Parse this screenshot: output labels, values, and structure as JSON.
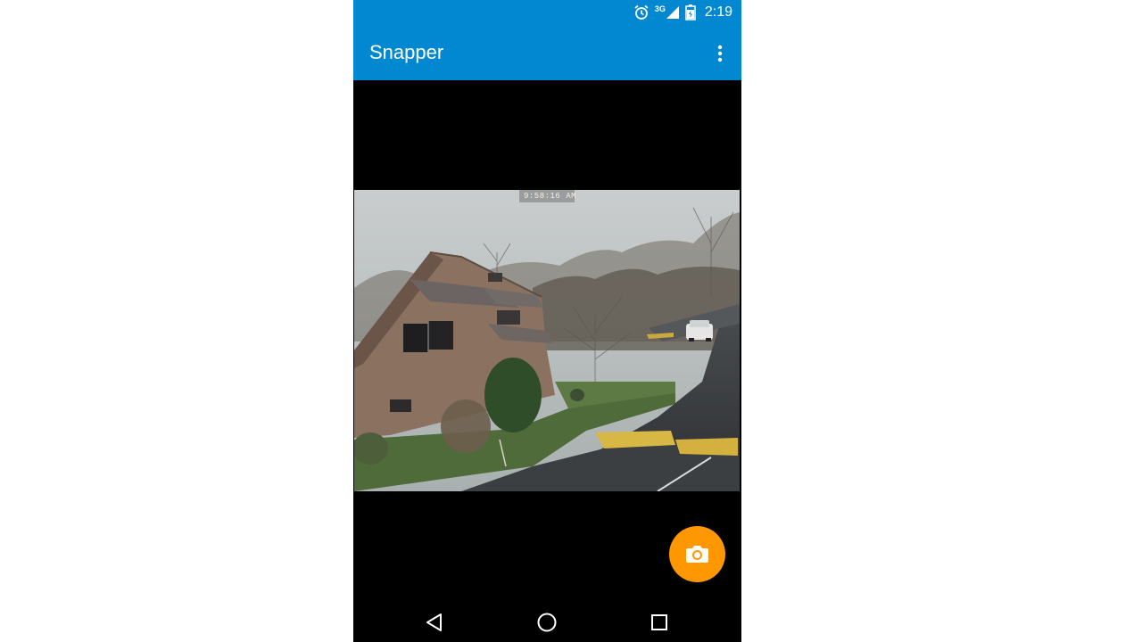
{
  "status_bar": {
    "time": "2:19",
    "network": "3G",
    "icons": [
      "alarm-icon",
      "signal-icon",
      "battery-icon"
    ]
  },
  "app_bar": {
    "title": "Snapper",
    "menu_icon": "more-vert-icon"
  },
  "camera_view": {
    "timestamp": "9:58:16 AM"
  },
  "fab": {
    "icon": "camera-icon",
    "color": "#ff9800"
  },
  "nav_bar": {
    "buttons": [
      "back-icon",
      "home-icon",
      "recents-icon"
    ]
  },
  "colors": {
    "primary": "#0288d1",
    "accent": "#ff9800",
    "background": "#000000"
  }
}
